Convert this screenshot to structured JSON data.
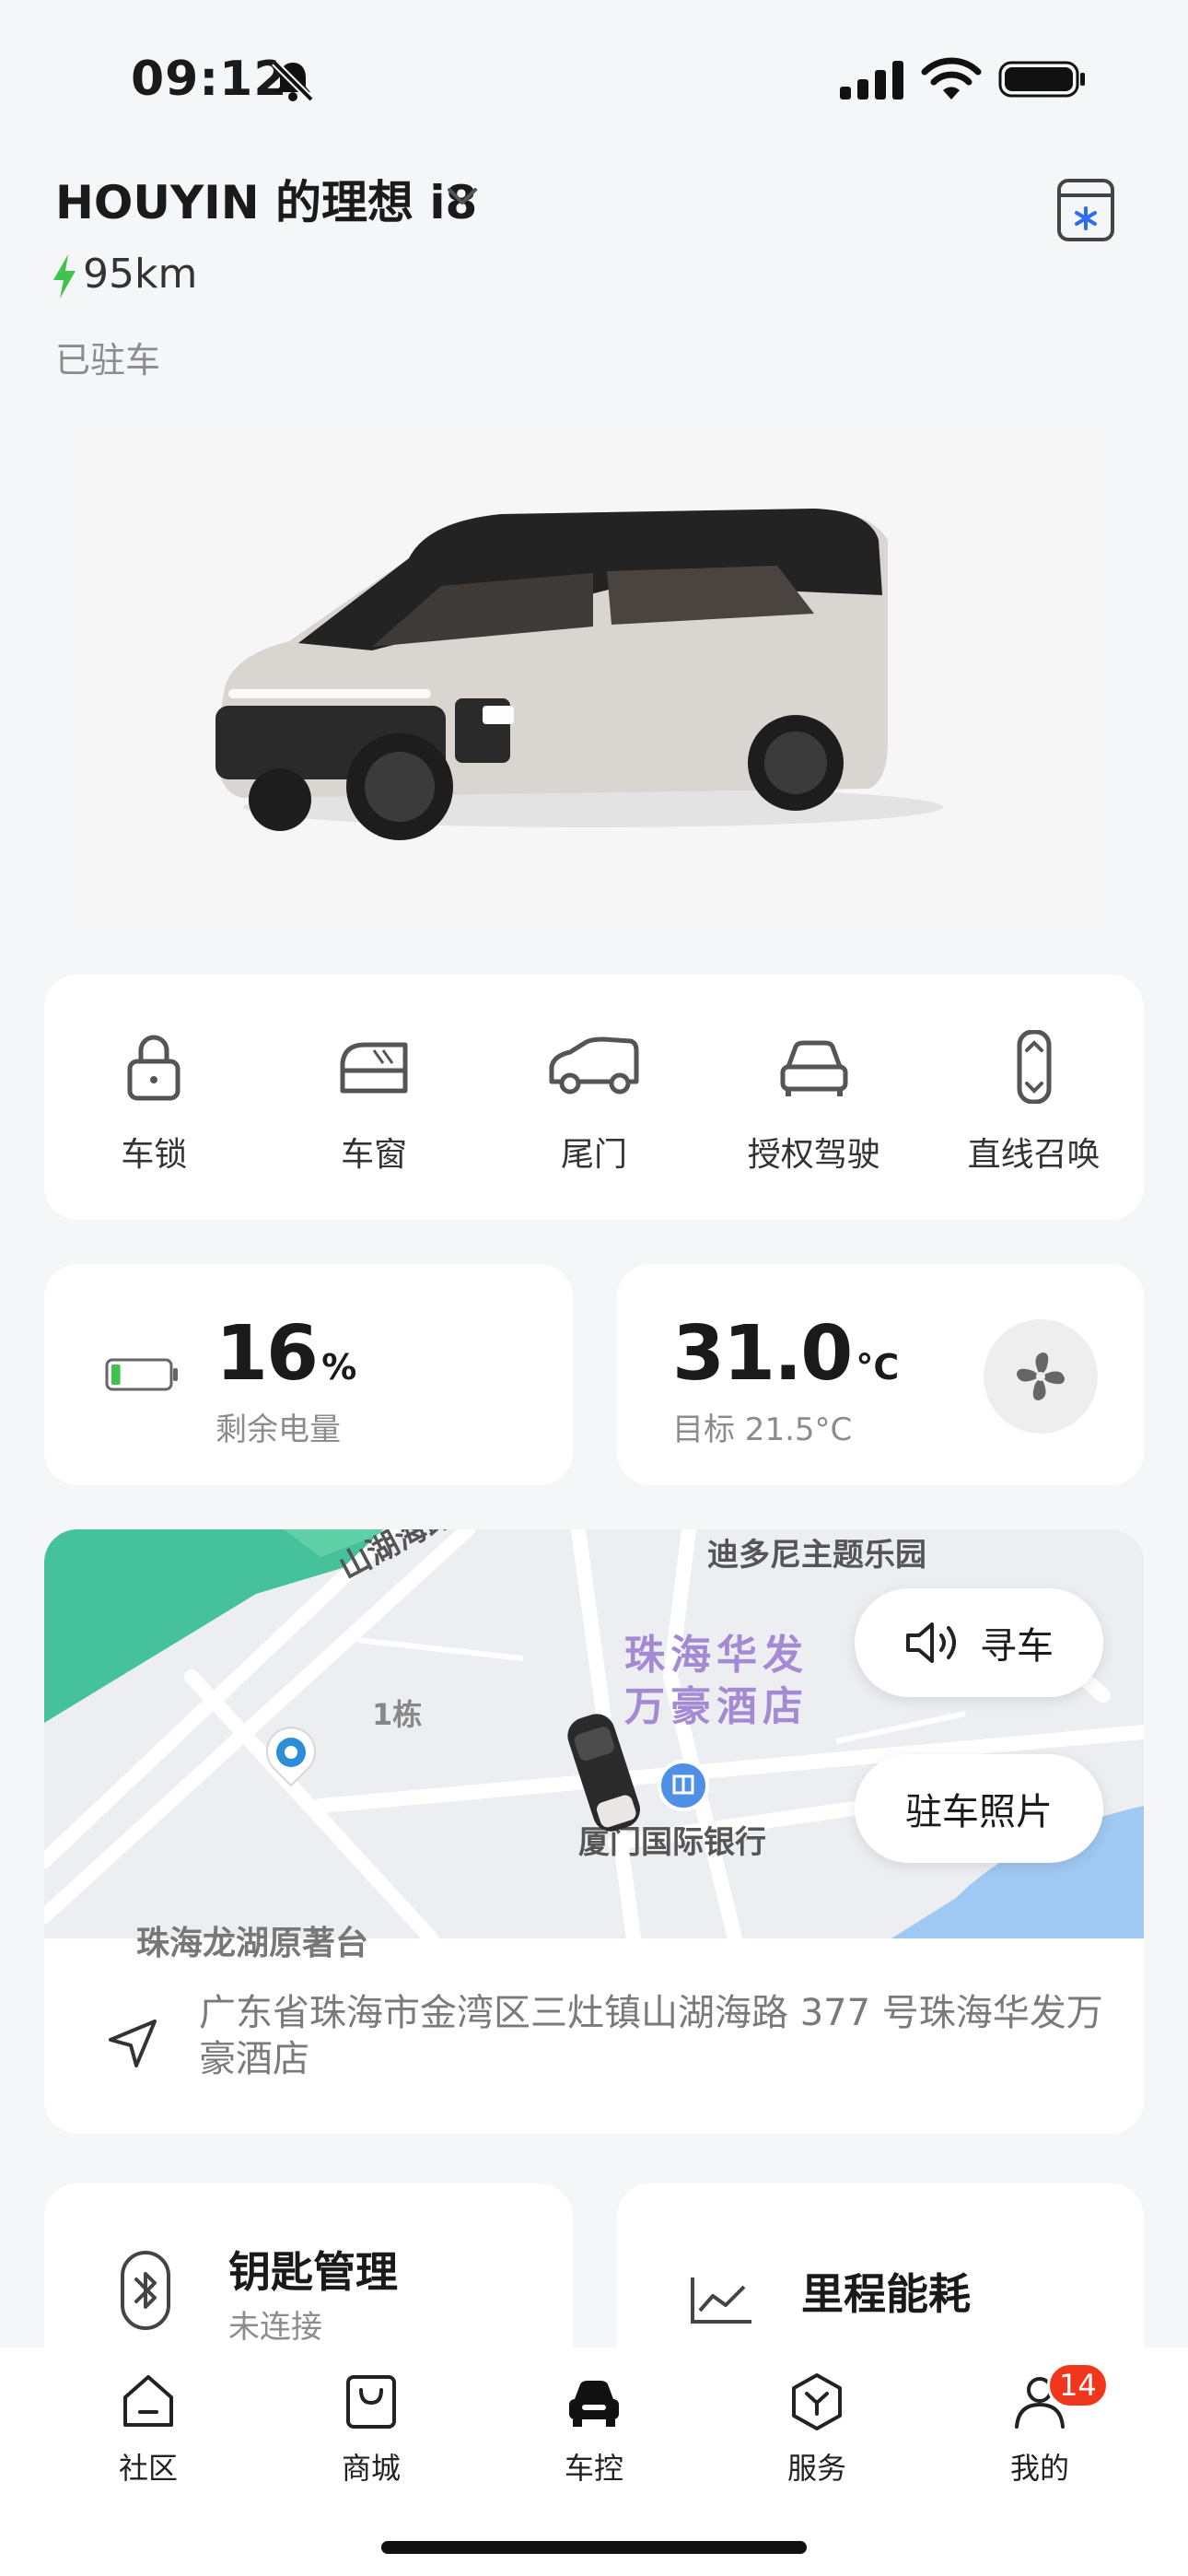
{
  "status_bar": {
    "time": "09:12"
  },
  "header": {
    "car_name": "HOUYIN 的理想 i8",
    "range": "95km",
    "state": "已驻车"
  },
  "quick_actions": [
    {
      "label": "车锁",
      "icon": "lock-icon"
    },
    {
      "label": "车窗",
      "icon": "window-icon"
    },
    {
      "label": "尾门",
      "icon": "tailgate-icon"
    },
    {
      "label": "授权驾驶",
      "icon": "authorized-driving-icon"
    },
    {
      "label": "直线召唤",
      "icon": "summon-icon"
    }
  ],
  "battery": {
    "value": "16",
    "unit": "%",
    "label": "剩余电量",
    "level": 0.16
  },
  "climate": {
    "value": "31.0",
    "unit": "°C",
    "target": "目标 21.5°C"
  },
  "map": {
    "labels": [
      "迪多尼主题乐园",
      "山湖海路",
      "珠海华发",
      "万豪酒店",
      "1栋",
      "厦门国际银行",
      "珠海龙湖原著台"
    ],
    "find_car": "寻车",
    "parking_photo": "驻车照片",
    "address": "广东省珠海市金湾区三灶镇山湖海路 377 号珠海华发万豪酒店"
  },
  "key": {
    "title": "钥匙管理",
    "status": "未连接"
  },
  "mileage": {
    "title": "里程能耗"
  },
  "nav": [
    {
      "label": "社区",
      "icon": "community-icon"
    },
    {
      "label": "商城",
      "icon": "store-icon"
    },
    {
      "label": "车控",
      "icon": "car-control-icon",
      "active": true
    },
    {
      "label": "服务",
      "icon": "service-icon"
    },
    {
      "label": "我的",
      "icon": "profile-icon",
      "badge": "14"
    }
  ],
  "colors": {
    "accent_green": "#3ec34b",
    "badge_red": "#f0371d",
    "water_blue": "#9fc9f2",
    "park_green": "#46c29a"
  }
}
